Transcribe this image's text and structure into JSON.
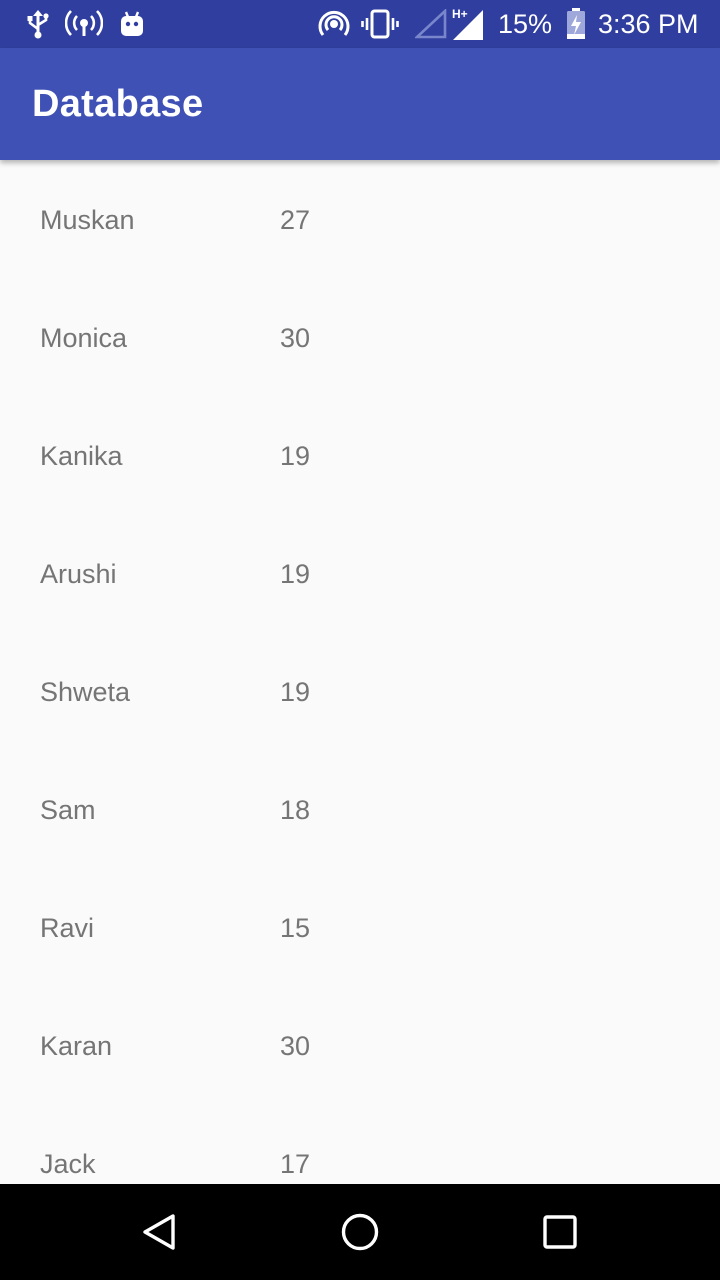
{
  "status_bar": {
    "icons_left": [
      "usb-icon",
      "hotspot-icon",
      "android-icon"
    ],
    "icons_right": [
      "nfc-icon",
      "vibrate-icon",
      "signal-empty-icon",
      "signal-hplus-icon",
      "battery-charging-icon"
    ],
    "network_type": "H+",
    "battery": "15%",
    "time": "3:36 PM"
  },
  "app_bar": {
    "title": "Database"
  },
  "list": {
    "rows": [
      {
        "name": "Muskan",
        "age": "27"
      },
      {
        "name": "Monica",
        "age": "30"
      },
      {
        "name": "Kanika",
        "age": "19"
      },
      {
        "name": "Arushi",
        "age": "19"
      },
      {
        "name": "Shweta",
        "age": "19"
      },
      {
        "name": "Sam",
        "age": "18"
      },
      {
        "name": "Ravi",
        "age": "15"
      },
      {
        "name": "Karan",
        "age": "30"
      },
      {
        "name": "Jack",
        "age": "17"
      }
    ]
  },
  "nav_bar": {
    "buttons": [
      "back-icon",
      "home-icon",
      "recents-icon"
    ]
  },
  "colors": {
    "status_bar": "#303f9f",
    "app_bar": "#3f51b5",
    "background": "#fafafa",
    "list_text": "#757575",
    "nav_bar": "#000000"
  }
}
